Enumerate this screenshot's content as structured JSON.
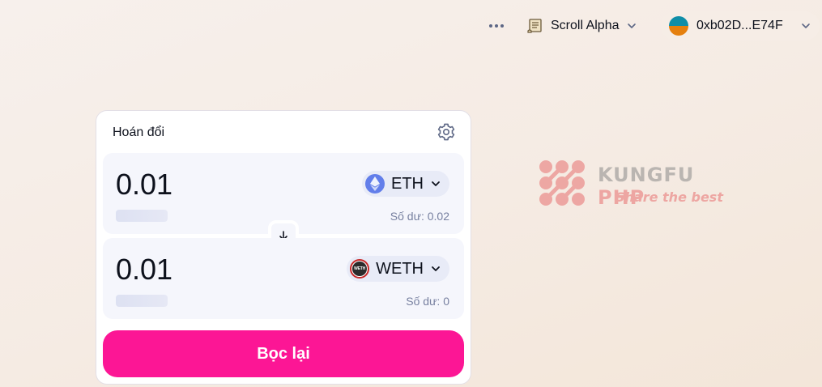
{
  "header": {
    "more_icon": "more-horizontal-icon",
    "network": {
      "label": "Scroll Alpha",
      "icon": "scroll-icon"
    },
    "wallet": {
      "address": "0xb02D...E74F",
      "avatar_colors": [
        "#0f8ea8",
        "#e5800e"
      ]
    }
  },
  "swap": {
    "title": "Hoán đổi",
    "settings_icon": "gear-icon",
    "input": {
      "amount": "0.01",
      "token": "ETH",
      "balance": "Số dư: 0.02"
    },
    "output": {
      "amount": "0.01",
      "token": "WETH",
      "token_icon_text": "WETH",
      "balance": "Số dư: 0"
    },
    "switch_icon": "arrow-down-icon",
    "action_label": "Bọc lại"
  },
  "watermark": {
    "brand_main": "KUNGFU",
    "brand_accent": "PHP",
    "tagline": "Share the best"
  },
  "colors": {
    "accent": "#fc1695",
    "panel_bg": "#f5f6fc",
    "token_bg": "#e8ebf7",
    "muted_text": "#7780a0"
  }
}
